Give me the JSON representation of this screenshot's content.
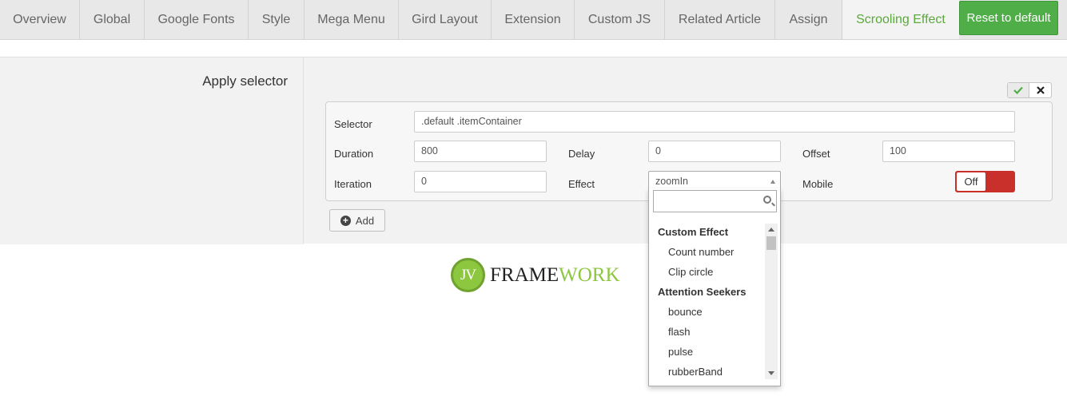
{
  "tabs": [
    {
      "label": "Overview"
    },
    {
      "label": "Global"
    },
    {
      "label": "Google Fonts"
    },
    {
      "label": "Style"
    },
    {
      "label": "Mega Menu"
    },
    {
      "label": "Gird Layout"
    },
    {
      "label": "Extension"
    },
    {
      "label": "Custom JS"
    },
    {
      "label": "Related Article"
    },
    {
      "label": "Assign"
    },
    {
      "label": "Scrooling Effect",
      "active": true
    }
  ],
  "reset_label": "Reset to default",
  "section": {
    "title": "Apply selector"
  },
  "form": {
    "selector_label": "Selector",
    "selector_value": ".default .itemContainer",
    "duration_label": "Duration",
    "duration_value": "800",
    "delay_label": "Delay",
    "delay_value": "0",
    "offset_label": "Offset",
    "offset_value": "100",
    "iteration_label": "Iteration",
    "iteration_value": "0",
    "effect_label": "Effect",
    "effect_value": "zoomIn",
    "mobile_label": "Mobile",
    "mobile_toggle": "Off"
  },
  "add_label": "Add",
  "logo": {
    "prefix": "JV",
    "text_main": "FRAME",
    "text_highlight": "WORK",
    "accent_color": "#8dc63f"
  },
  "dropdown": {
    "search_value": "",
    "items": [
      {
        "type": "group",
        "label": "Custom Effect"
      },
      {
        "type": "option",
        "label": "Count number"
      },
      {
        "type": "option",
        "label": "Clip circle"
      },
      {
        "type": "group",
        "label": "Attention Seekers"
      },
      {
        "type": "option",
        "label": "bounce"
      },
      {
        "type": "option",
        "label": "flash"
      },
      {
        "type": "option",
        "label": "pulse"
      },
      {
        "type": "option",
        "label": "rubberBand"
      }
    ]
  },
  "colors": {
    "active_tab": "#5ca83c",
    "reset_button": "#4fae47",
    "toggle_off": "#c9302c"
  }
}
